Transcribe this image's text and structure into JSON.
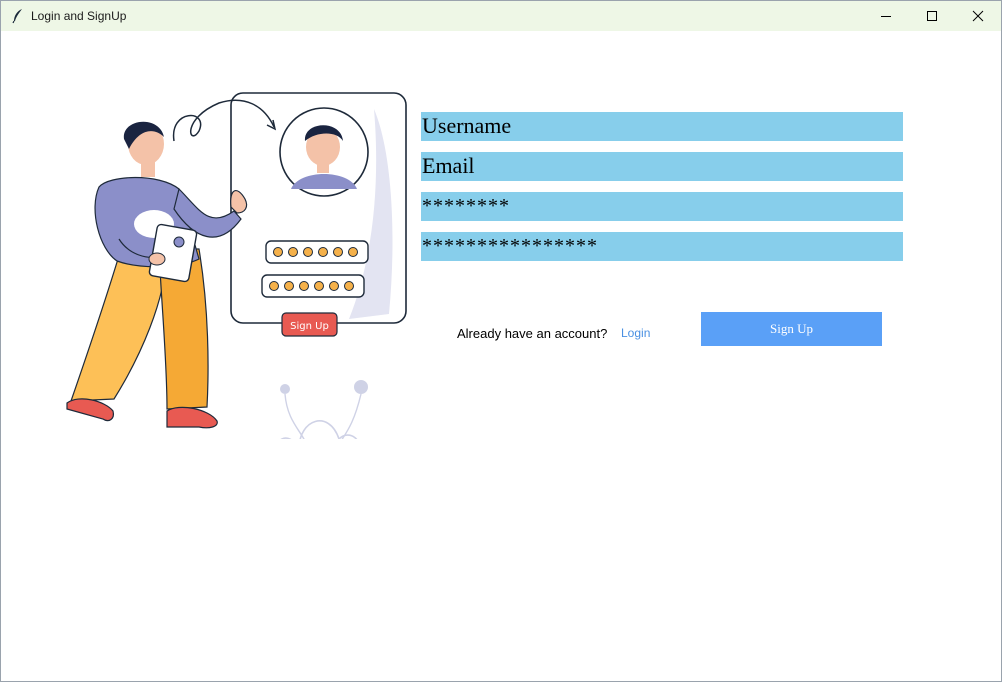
{
  "window": {
    "title": "Login and SignUp",
    "controls": [
      "minimize",
      "maximize",
      "close"
    ]
  },
  "illustration": {
    "button_text": "Sign Up"
  },
  "form": {
    "username_value": "Username",
    "email_value": "Email",
    "password_value": "********",
    "confirm_password_value": "****************",
    "field_color": "#87ceeb"
  },
  "footer": {
    "already_text": "Already have an account?",
    "login_link": "Login",
    "signup_button": "Sign Up",
    "signup_button_color": "#5aa0f7",
    "link_color": "#4a90e2"
  }
}
